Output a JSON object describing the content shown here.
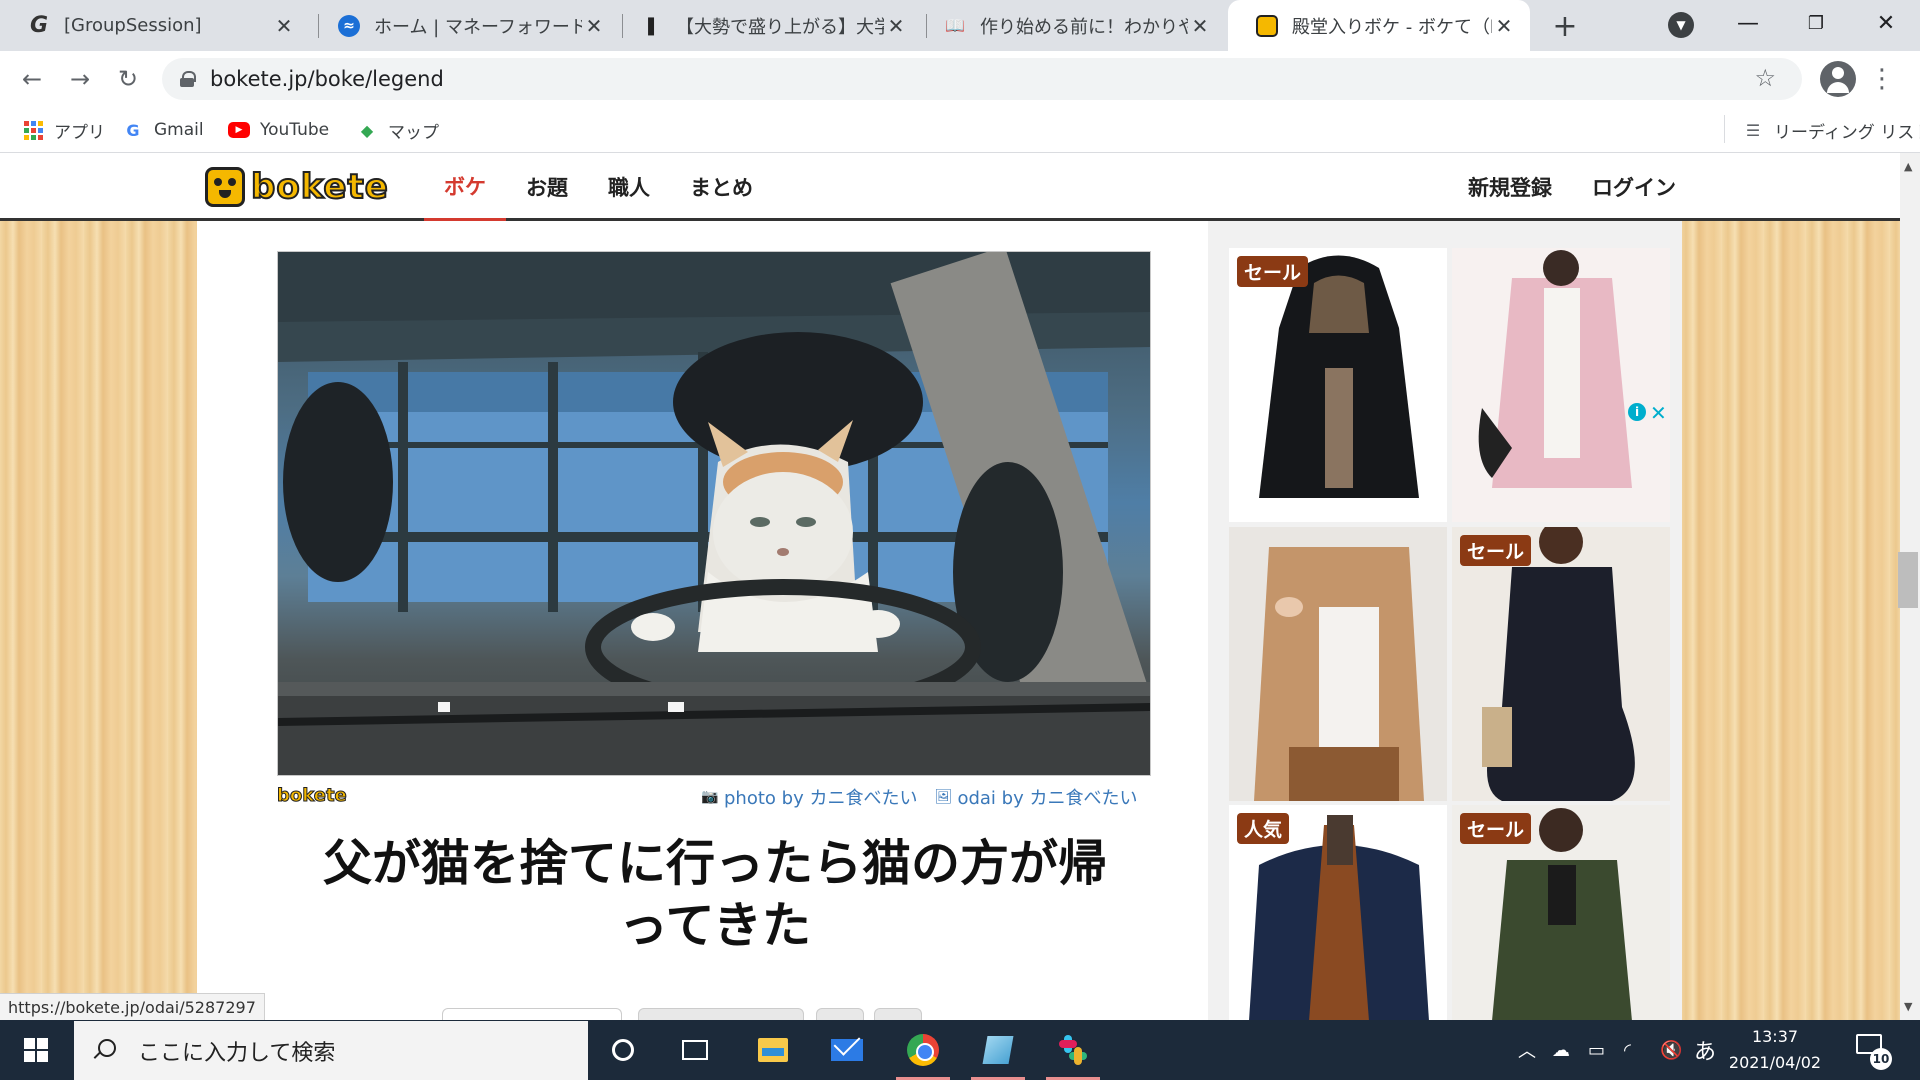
{
  "browser": {
    "tabs": [
      {
        "title": "[GroupSession]",
        "icon": "groupsession-icon",
        "favicon_text": "G"
      },
      {
        "title": "ホーム | マネーフォワード クラウド",
        "icon": "moneyforward-icon",
        "favicon_text": "≈"
      },
      {
        "title": "【大勢で盛り上がる】大学生に",
        "icon": "page-icon",
        "favicon_text": "❚"
      },
      {
        "title": "作り始める前に！わかりやすい",
        "icon": "book-icon",
        "favicon_text": "📖"
      },
      {
        "title": "殿堂入りボケ - ボケて（boke",
        "icon": "bokete-icon",
        "favicon_text": ""
      }
    ],
    "url": "bokete.jp/boke/legend",
    "bookmarks": [
      {
        "label": "アプリ",
        "icon": "apps-grid-icon"
      },
      {
        "label": "Gmail",
        "icon": "google-icon"
      },
      {
        "label": "YouTube",
        "icon": "youtube-icon"
      },
      {
        "label": "マップ",
        "icon": "maps-icon"
      }
    ],
    "reading_list": "リーディング リスト",
    "status_url": "https://bokete.jp/odai/5287297"
  },
  "site": {
    "logo_text": "bokete",
    "nav": [
      {
        "label": "ボケ",
        "active": true
      },
      {
        "label": "お題",
        "active": false
      },
      {
        "label": "職人",
        "active": false
      },
      {
        "label": "まとめ",
        "active": false
      }
    ],
    "auth": [
      {
        "label": "新規登録"
      },
      {
        "label": "ログイン"
      }
    ]
  },
  "post": {
    "mini_logo": "bokete",
    "photo_credit": "photo by カニ食べたい",
    "odai_credit": "odai by カニ食べたい",
    "boke_text": "父が猫を捨てに行ったら猫の方が帰ってきた"
  },
  "ads": [
    {
      "badge": "セール",
      "item": "black-hooded-coat"
    },
    {
      "badge": "",
      "item": "pink-cardigan"
    },
    {
      "badge": "",
      "item": "camel-cardigan"
    },
    {
      "badge": "セール",
      "item": "navy-dress"
    },
    {
      "badge": "人気",
      "item": "navy-jacket"
    },
    {
      "badge": "セール",
      "item": "green-coat"
    }
  ],
  "taskbar": {
    "search_placeholder": "ここに入力して検索",
    "ime": "あ",
    "time": "13:37",
    "date": "2021/04/02",
    "notification_count": "10"
  },
  "colors": {
    "accent_red": "#d43a2f",
    "logo_yellow": "#f5b800",
    "link_blue": "#3a78b9",
    "ad_badge": "#8b3a14"
  }
}
